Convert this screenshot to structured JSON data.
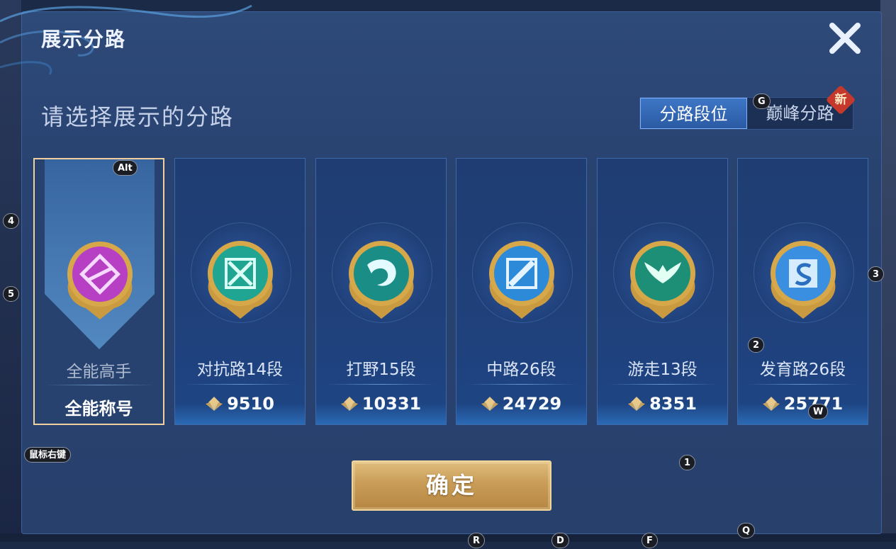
{
  "dialog": {
    "title": "展示分路",
    "subtitle": "请选择展示的分路"
  },
  "tabs": [
    {
      "label": "分路段位",
      "active": true
    },
    {
      "label": "巅峰分路",
      "active": false
    }
  ],
  "new_badge": "新",
  "lanes": [
    {
      "name": "全能高手",
      "score_label": "全能称号",
      "selected": true,
      "emblem_color": "#b63fc3",
      "emblem": "all-round-emblem-icon"
    },
    {
      "name": "对抗路14段",
      "score": "9510",
      "selected": false,
      "emblem_color": "#1fa591",
      "emblem": "clash-lane-emblem-icon"
    },
    {
      "name": "打野15段",
      "score": "10331",
      "selected": false,
      "emblem_color": "#198d86",
      "emblem": "jungle-dragon-emblem-icon"
    },
    {
      "name": "中路26段",
      "score": "24729",
      "selected": false,
      "emblem_color": "#2d8ad8",
      "emblem": "mid-lane-emblem-icon"
    },
    {
      "name": "游走13段",
      "score": "8351",
      "selected": false,
      "emblem_color": "#1d8f77",
      "emblem": "roam-wings-emblem-icon"
    },
    {
      "name": "发育路26段",
      "score": "25771",
      "selected": false,
      "emblem_color": "#3a8fe0",
      "emblem": "farm-lane-emblem-icon"
    }
  ],
  "confirm_label": "确定",
  "hotkeys": {
    "alt": "Alt",
    "g": "G",
    "n4": "4",
    "n5": "5",
    "n3": "3",
    "n2": "2",
    "w": "W",
    "n1": "1",
    "right_click": "鼠标右键",
    "q": "Q",
    "r": "R",
    "d": "D",
    "f": "F"
  },
  "colors": {
    "panel": "#294371",
    "gold": "#f2cf9e",
    "tab_active": "#3d76c6"
  }
}
